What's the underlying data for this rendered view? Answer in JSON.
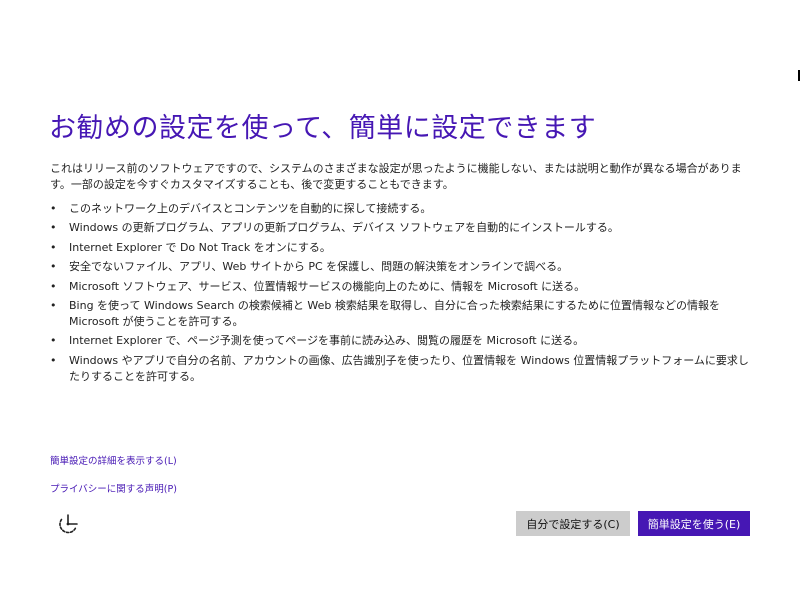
{
  "header": {
    "title": "お勧めの設定を使って、簡単に設定できます"
  },
  "intro": {
    "text": "これはリリース前のソフトウェアですので、システムのさまざまな設定が思ったように機能しない、または説明と動作が異なる場合があります。一部の設定を今すぐカスタマイズすることも、後で変更することもできます。"
  },
  "bullets": {
    "marker": "•",
    "items": [
      "このネットワーク上のデバイスとコンテンツを自動的に探して接続する。",
      "Windows の更新プログラム、アプリの更新プログラム、デバイス ソフトウェアを自動的にインストールする。",
      "Internet Explorer で Do Not Track をオンにする。",
      "安全でないファイル、アプリ、Web サイトから PC を保護し、問題の解決策をオンラインで調べる。",
      "Microsoft ソフトウェア、サービス、位置情報サービスの機能向上のために、情報を Microsoft に送る。",
      "Bing を使って Windows Search の検索候補と Web 検索結果を取得し、自分に合った検索結果にするために位置情報などの情報を Microsoft が使うことを許可する。",
      "Internet Explorer で、ページ予測を使ってページを事前に読み込み、閲覧の履歴を Microsoft に送る。",
      "Windows やアプリで自分の名前、アカウントの画像、広告識別子を使ったり、位置情報を Windows 位置情報プラットフォームに要求したりすることを許可する。"
    ]
  },
  "links": {
    "details": "簡単設定の詳細を表示する(L)",
    "privacy": "プライバシーに関する声明(P)"
  },
  "footer": {
    "accessibility_icon": "ease-of-access-icon",
    "custom_button": "自分で設定する(C)",
    "express_button": "簡単設定を使う(E)"
  },
  "colors": {
    "accent": "#4617b4",
    "secondary_button": "#cccccc",
    "background": "#ffffff"
  }
}
